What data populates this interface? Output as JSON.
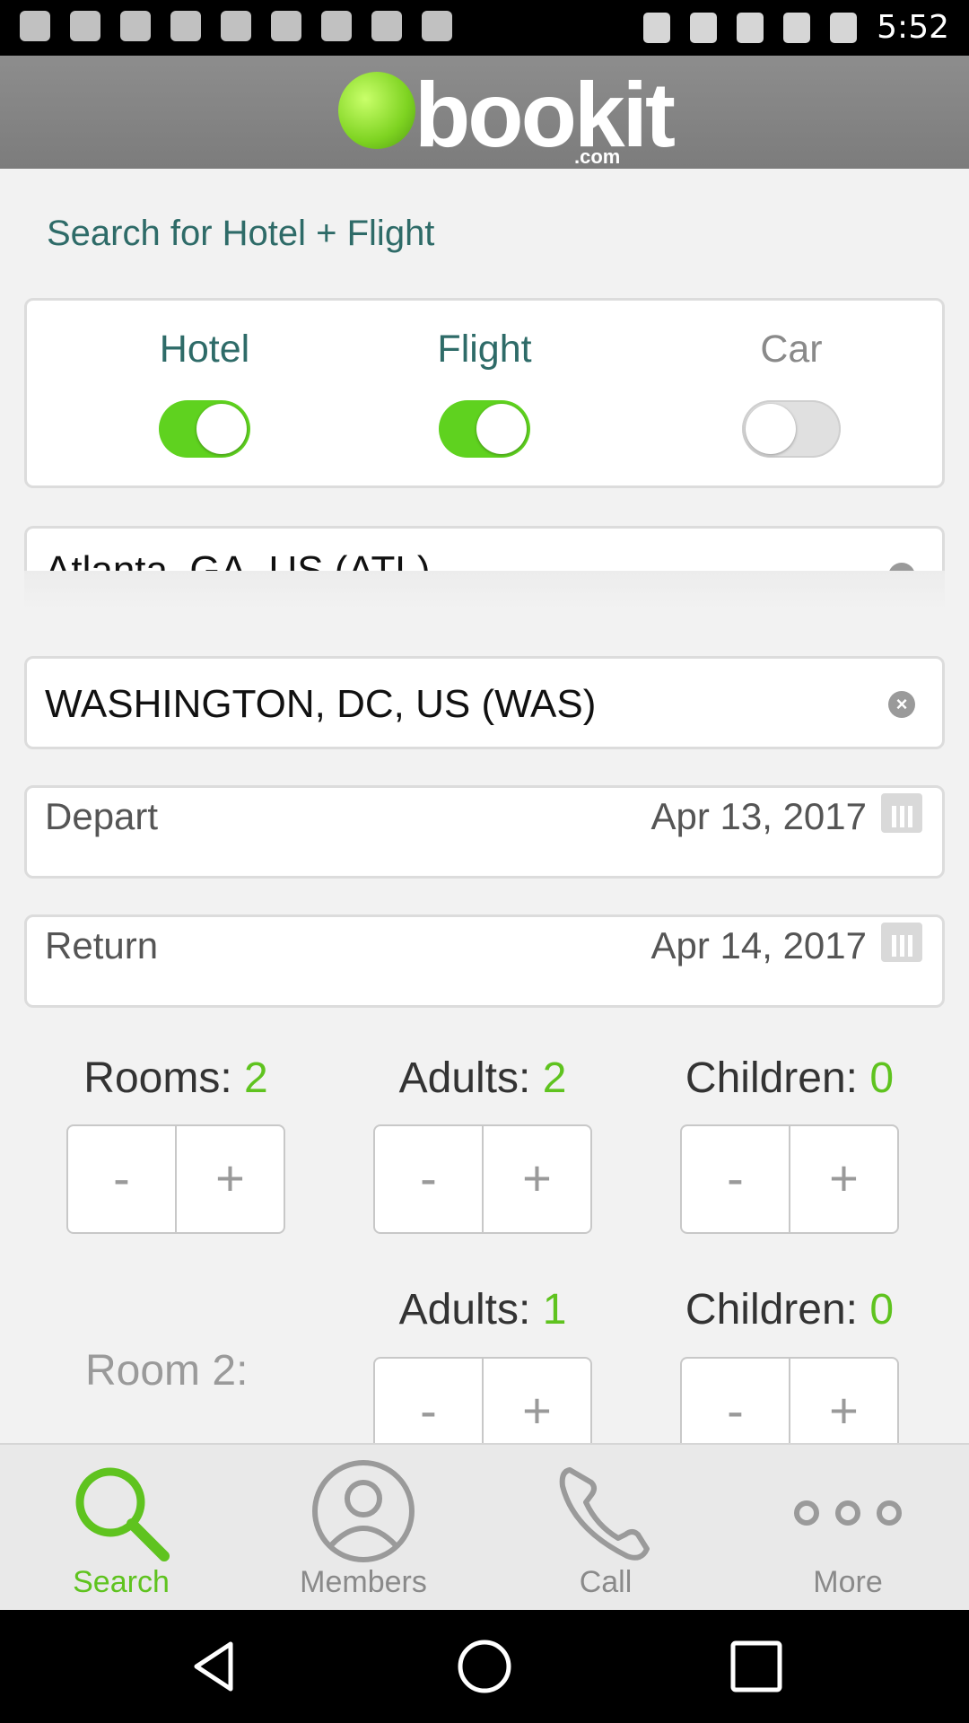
{
  "status_bar": {
    "time": "5:52"
  },
  "header": {
    "logo_word": "bookit",
    "logo_suffix": ".com",
    "logo_color": "#7ed321"
  },
  "page_title": "Search for Hotel + Flight",
  "toggles": [
    {
      "label": "Hotel",
      "on": true
    },
    {
      "label": "Flight",
      "on": true
    },
    {
      "label": "Car",
      "on": false
    }
  ],
  "origin": {
    "value": "Atlanta, GA, US (ATL)"
  },
  "destination": {
    "value": "WASHINGTON, DC, US (WAS)"
  },
  "depart": {
    "label": "Depart",
    "date": "Apr 13, 2017"
  },
  "return": {
    "label": "Return",
    "date": "Apr 14, 2017"
  },
  "counters": {
    "rooms": {
      "label": "Rooms: ",
      "value": "2"
    },
    "adults": {
      "label": "Adults: ",
      "value": "2"
    },
    "children": {
      "label": "Children: ",
      "value": "0"
    }
  },
  "room2": {
    "label": "Room 2:",
    "adults": {
      "label": "Adults: ",
      "value": "1"
    },
    "children": {
      "label": "Children: ",
      "value": "0"
    }
  },
  "stepper": {
    "minus": "-",
    "plus": "+"
  },
  "tabs": [
    {
      "label": "Search",
      "icon": "search-icon",
      "active": true
    },
    {
      "label": "Members",
      "icon": "person-icon",
      "active": false
    },
    {
      "label": "Call",
      "icon": "phone-icon",
      "active": false
    },
    {
      "label": "More",
      "icon": "more-icon",
      "active": false
    }
  ],
  "colors": {
    "accent_green": "#5fc31f",
    "title_teal": "#2e6b68",
    "header_gray": "#858585"
  }
}
